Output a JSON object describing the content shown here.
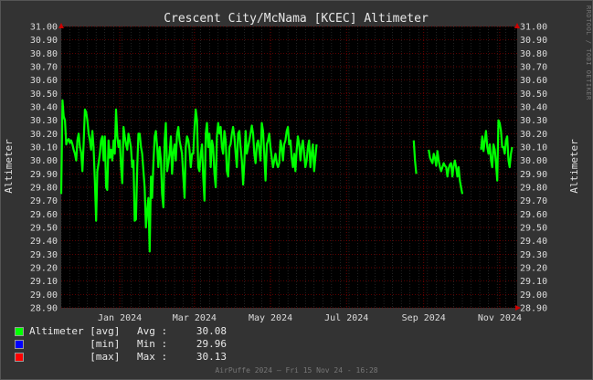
{
  "chart_data": {
    "type": "line",
    "title": "Crescent City/McNama [KCEC] Altimeter",
    "ylabel": "Altimeter",
    "ylabel_right": "Altimeter",
    "ylim": [
      28.9,
      31.0
    ],
    "yticks": [
      "31.00",
      "30.90",
      "30.80",
      "30.70",
      "30.60",
      "30.50",
      "30.40",
      "30.30",
      "30.20",
      "30.10",
      "30.00",
      "29.90",
      "29.80",
      "29.70",
      "29.60",
      "29.50",
      "29.40",
      "29.30",
      "29.20",
      "29.10",
      "29.00",
      "28.90"
    ],
    "xlim": [
      "2023-11-15",
      "2024-11-15"
    ],
    "xticks": [
      {
        "label": "Jan 2024",
        "date": "2024-01-01"
      },
      {
        "label": "Mar 2024",
        "date": "2024-03-01"
      },
      {
        "label": "May 2024",
        "date": "2024-05-01"
      },
      {
        "label": "Jul 2024",
        "date": "2024-07-01"
      },
      {
        "label": "Sep 2024",
        "date": "2024-09-01"
      },
      {
        "label": "Nov 2024",
        "date": "2024-11-01"
      }
    ],
    "grid": true,
    "colors": {
      "avg": "#00ff00",
      "min": "#0000ff",
      "max": "#ff0000",
      "plot_bg": "#000000",
      "grid": "#444444",
      "minor_grid": "#8b0000"
    },
    "series": [
      {
        "name": "Altimeter [avg]",
        "color": "#00ff00",
        "segments": [
          {
            "start": "2023-11-15",
            "step_days": 1,
            "values": [
              29.75,
              30.45,
              30.33,
              30.3,
              30.12,
              30.15,
              30.16,
              30.13,
              30.15,
              30.12,
              30.08,
              30.05,
              30.0,
              30.15,
              30.2,
              30.1,
              30.06,
              29.92,
              30.12,
              30.38,
              30.36,
              30.3,
              30.2,
              30.15,
              30.08,
              30.22,
              30.1,
              29.85,
              29.55,
              29.92,
              29.98,
              30.05,
              30.15,
              30.18,
              30.0,
              30.18,
              29.8,
              29.78,
              30.15,
              30.02,
              30.08,
              30.0,
              30.15,
              30.05,
              30.38,
              30.18,
              30.1,
              30.15,
              29.96,
              29.83,
              30.25,
              30.18,
              30.12,
              30.08,
              30.2,
              30.15,
              30.1,
              29.95,
              30.0,
              29.55,
              29.56,
              29.95,
              30.2,
              30.2,
              30.1,
              30.05,
              29.92,
              29.8,
              29.5,
              29.63,
              29.72,
              29.32,
              29.88,
              29.72,
              29.98,
              30.18,
              30.22,
              30.1,
              29.95,
              30.1,
              30.0,
              29.75,
              29.65,
              30.15,
              30.28,
              29.92,
              29.98,
              30.05,
              30.18,
              29.9,
              30.06,
              30.12,
              30.0,
              30.2,
              30.25,
              30.15,
              30.1,
              30.05,
              29.88,
              29.72,
              30.1,
              30.18,
              30.15,
              30.08,
              29.95,
              30.05,
              30.05,
              30.25,
              30.38,
              30.3,
              29.95,
              29.92,
              30.05,
              30.12,
              29.88,
              29.7,
              30.2,
              30.28,
              30.1,
              30.2,
              29.95,
              30.15,
              30.1,
              29.9,
              29.8,
              30.18,
              30.28,
              30.2,
              30.25,
              30.1,
              30.05,
              30.22,
              30.15,
              29.92,
              29.88,
              30.1,
              30.12,
              30.2,
              30.25,
              30.18,
              30.05,
              29.95,
              30.2,
              30.22,
              30.1,
              30.0,
              29.82,
              29.98,
              30.22,
              30.05,
              30.1,
              30.15,
              30.2,
              30.26,
              30.2,
              30.05,
              29.98,
              30.12,
              30.15,
              30.08,
              30.0,
              30.28,
              30.22,
              30.05,
              29.85,
              30.12,
              30.15,
              30.2,
              30.1,
              30.02,
              29.95,
              30.0,
              30.05,
              29.98,
              29.95,
              29.98,
              30.15,
              30.1,
              30.0,
              30.12,
              30.15,
              30.22,
              30.25,
              30.12,
              30.15,
              30.02,
              29.95,
              30.05,
              29.92,
              30.08,
              30.18,
              30.12,
              30.0,
              30.1,
              30.15,
              30.05,
              29.95,
              30.0,
              30.1,
              30.15,
              29.95,
              30.05,
              30.12,
              29.92,
              30.02,
              30.12
            ]
          },
          {
            "start": "2024-08-24",
            "step_days": 1,
            "values": [
              30.15,
              30.0,
              29.9
            ]
          },
          {
            "start": "2024-09-05",
            "step_days": 1,
            "values": [
              30.08,
              30.02,
              30.0,
              29.98,
              30.05,
              30.02,
              29.96,
              30.07,
              30.0,
              29.95,
              29.92,
              29.95,
              29.98,
              29.96,
              29.95,
              29.88,
              29.94,
              29.97,
              29.98,
              29.88,
              29.96,
              30.0,
              29.95,
              29.88,
              29.95,
              29.85,
              29.8,
              29.75
            ]
          },
          {
            "start": "2024-10-17",
            "step_days": 1,
            "values": [
              30.08,
              30.18,
              30.07,
              30.15,
              30.22,
              30.1,
              30.05,
              30.12,
              30.0,
              29.95,
              30.12,
              30.08,
              29.98,
              29.85,
              30.3,
              30.28,
              30.22,
              30.1,
              30.1,
              30.05,
              30.15,
              30.18,
              30.0,
              29.95,
              30.05,
              30.1
            ]
          }
        ]
      }
    ],
    "legend": [
      {
        "color": "#00ff00",
        "label": "Altimeter [avg]",
        "stat": "Avg :",
        "value": "30.08"
      },
      {
        "color": "#0000ff",
        "label": "          [min]",
        "stat": "Min :",
        "value": "29.96"
      },
      {
        "color": "#ff0000",
        "label": "          [max]",
        "stat": "Max :",
        "value": "30.13"
      }
    ]
  },
  "footer": "AirPuffe 2024 — Fri 15 Nov 24 - 16:28",
  "watermark": "RRDTOOL / TOBI OETIKER"
}
